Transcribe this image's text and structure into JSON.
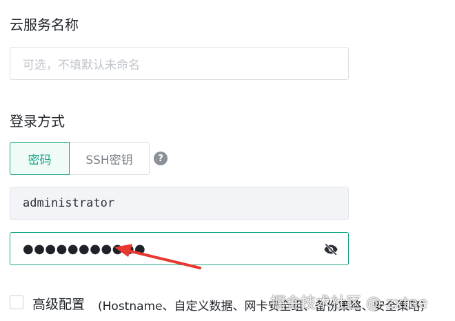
{
  "cloud_name": {
    "label": "云服务名称",
    "placeholder": "可选，不填默认未命名"
  },
  "login": {
    "label": "登录方式",
    "tabs": [
      "密码",
      "SSH密钥"
    ],
    "help_glyph": "?",
    "username_value": "administrator",
    "password_masked": "●●●●●●●●●●●"
  },
  "advanced": {
    "label": "高级配置",
    "description": "(Hostname、自定义数据、网卡安全组、备份策略、安全策略)"
  },
  "watermark": "掘金技术社区 @ zxtae",
  "colors": {
    "accent": "#1aa586",
    "arrow": "#e8372f"
  }
}
